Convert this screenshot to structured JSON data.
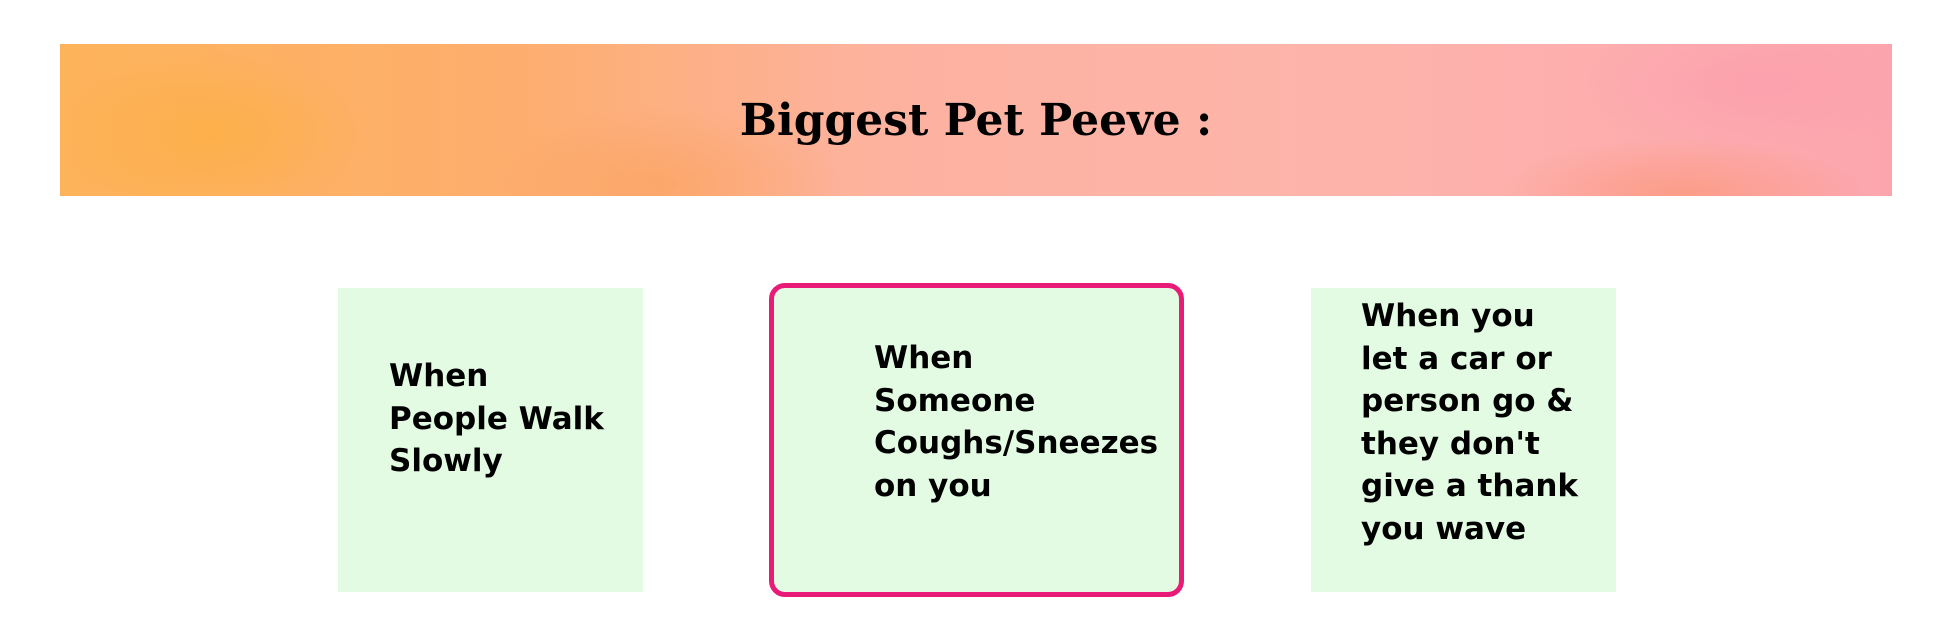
{
  "header": {
    "title": "Biggest Pet Peeve :"
  },
  "cards": [
    {
      "text": "When\nPeople Walk\nSlowly",
      "selected": false
    },
    {
      "text": "When\nSomeone\nCoughs/Sneezes\non you",
      "selected": true
    },
    {
      "text": "When you\nlet a car or\nperson go &\nthey don't\ngive a thank\nyou wave",
      "selected": false
    }
  ],
  "colors": {
    "card_background": "#e3fbe2",
    "selected_border": "#e81b77",
    "banner_start": "#fdb35a",
    "banner_end": "#fca5ad"
  }
}
